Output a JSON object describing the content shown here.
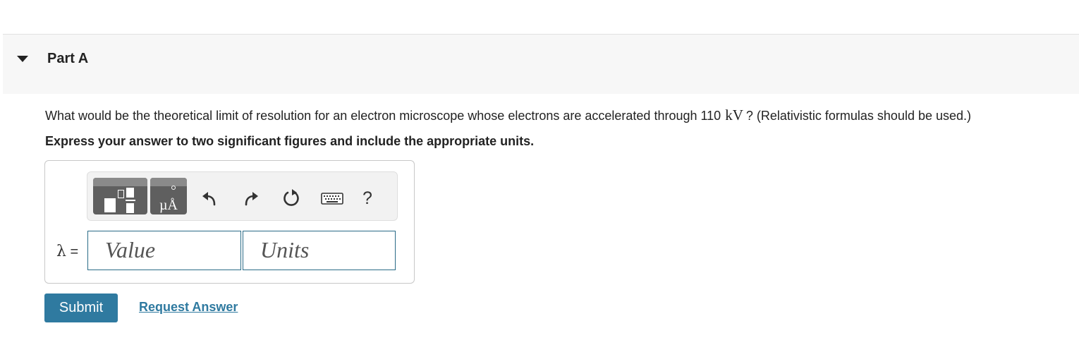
{
  "part": {
    "title": "Part A"
  },
  "question": {
    "text_before": "What would be the theoretical limit of resolution for an electron microscope whose electrons are accelerated through 110",
    "unit": "kV",
    "text_after": "? (Relativistic formulas should be used.)"
  },
  "instruction": "Express your answer to two significant figures and include the appropriate units.",
  "toolbar": {
    "units_button_label": "µÅ",
    "help_label": "?",
    "icons": [
      "templates-icon",
      "units-icon",
      "undo-icon",
      "redo-icon",
      "reset-icon",
      "keyboard-icon",
      "help-icon"
    ]
  },
  "answer": {
    "variable_symbol": "λ",
    "equals": "=",
    "value_placeholder": "Value",
    "units_placeholder": "Units"
  },
  "actions": {
    "submit_label": "Submit",
    "request_answer_label": "Request Answer"
  },
  "colors": {
    "accent": "#2f7aa0",
    "field_border": "#2a6b87",
    "toolbar_button": "#5f5f5f",
    "header_bg": "#f7f7f7"
  }
}
